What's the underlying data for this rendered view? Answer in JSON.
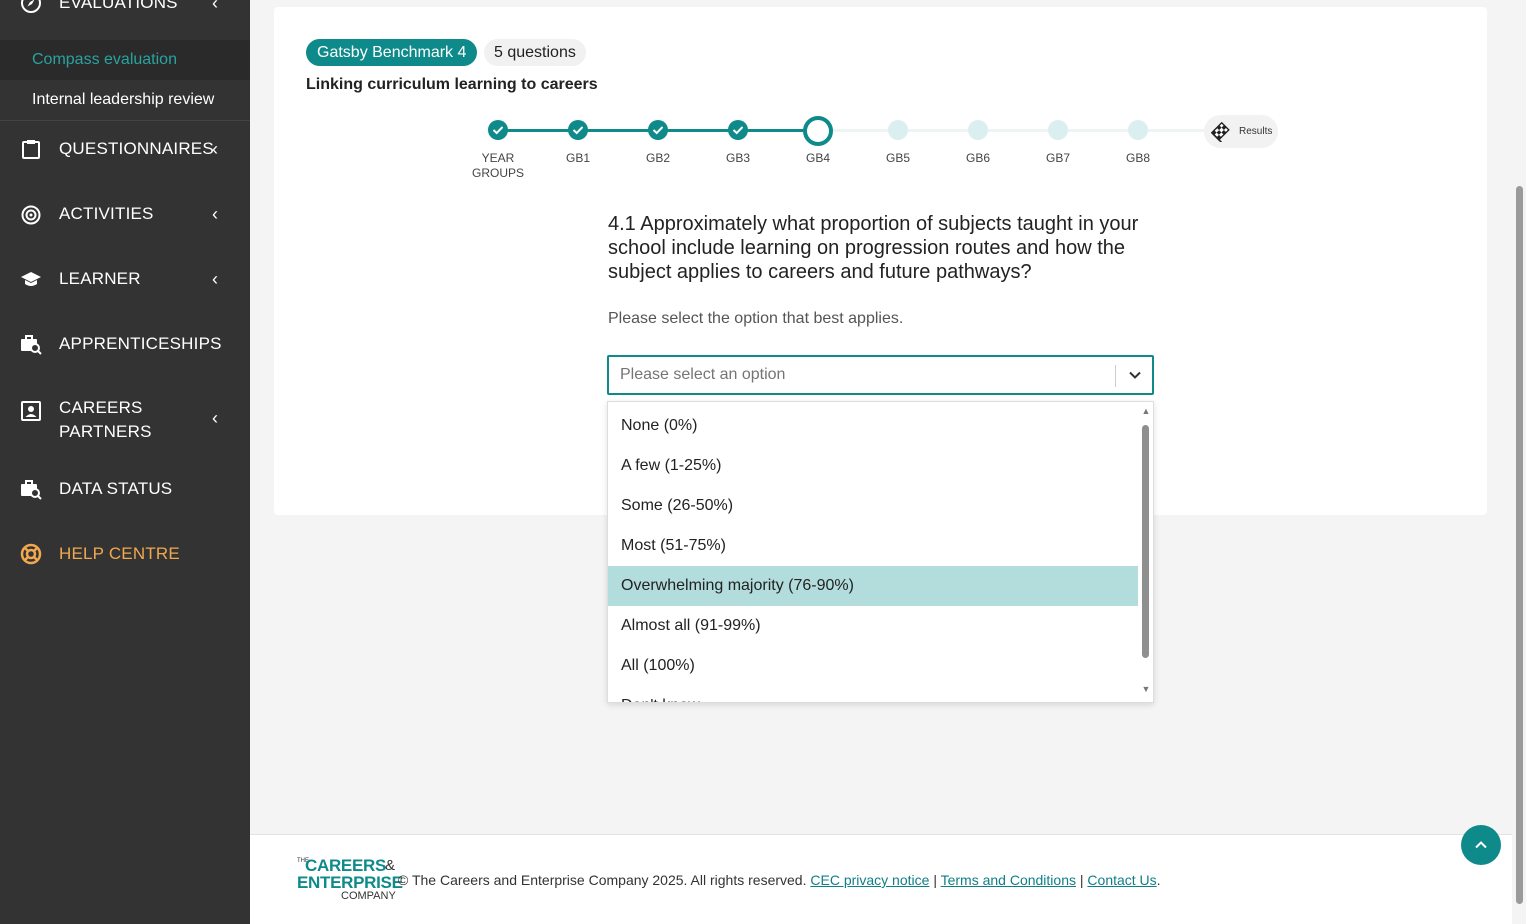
{
  "sidebar": {
    "evaluations_label": "EVALUATIONS",
    "sub_items": [
      "Compass evaluation",
      "Internal leadership review"
    ],
    "questionnaires_label": "QUESTIONNAIRES",
    "activities_label": "ACTIVITIES",
    "learner_label": "LEARNER",
    "apprenticeships_label": "APPRENTICESHIPS",
    "careers_partners_line1": "CAREERS",
    "careers_partners_line2": "PARTNERS",
    "data_status_label": "DATA STATUS",
    "help_centre_label": "HELP CENTRE",
    "chevron": "‹"
  },
  "card": {
    "benchmark_pill": "Gatsby Benchmark 4",
    "questions_pill": "5 questions",
    "title": "Linking curriculum learning to careers"
  },
  "stepper": {
    "steps": [
      {
        "label": "YEAR GROUPS",
        "state": "done"
      },
      {
        "label": "GB1",
        "state": "done"
      },
      {
        "label": "GB2",
        "state": "done"
      },
      {
        "label": "GB3",
        "state": "done"
      },
      {
        "label": "GB4",
        "state": "current"
      },
      {
        "label": "GB5",
        "state": "todo"
      },
      {
        "label": "GB6",
        "state": "todo"
      },
      {
        "label": "GB7",
        "state": "todo"
      },
      {
        "label": "GB8",
        "state": "todo"
      }
    ],
    "results_label": "Results"
  },
  "question": {
    "text": "4.1 Approximately what proportion of subjects taught in your school include learning on progression routes and how the subject applies to careers and future pathways?",
    "hint": "Please select the option that best applies.",
    "placeholder": "Please select an option",
    "options": [
      "None (0%)",
      "A few (1-25%)",
      "Some (26-50%)",
      "Most (51-75%)",
      "Overwhelming majority (76-90%)",
      "Almost all (91-99%)",
      "All (100%)",
      "Don't know"
    ],
    "highlighted_index": 4
  },
  "footer": {
    "logo_the": "THE",
    "logo_line1": "CAREERS",
    "logo_amp": "&",
    "logo_line2": "ENTERPRISE",
    "logo_line3": "COMPANY",
    "copyright": "© The Careers and Enterprise Company 2025. All rights reserved.",
    "privacy_link": "CEC privacy notice",
    "terms_link": "Terms and Conditions",
    "contact_link": "Contact Us",
    "separator": "|",
    "trailing": "."
  },
  "colors": {
    "accent": "#0f8a8a",
    "sidebar_bg": "#333333",
    "help_centre": "#f0a94e",
    "highlight": "#b3dcdc"
  }
}
